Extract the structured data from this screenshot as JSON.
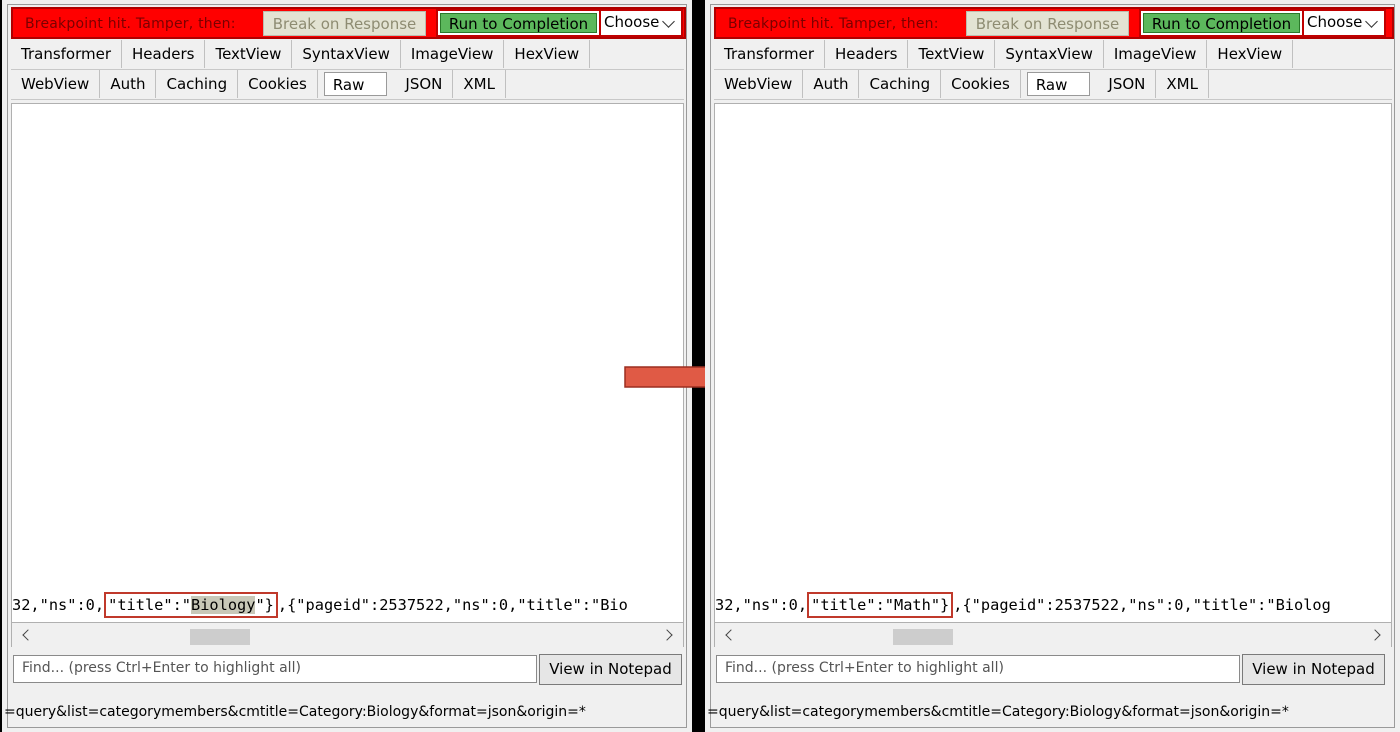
{
  "breakpoint_text": "Breakpoint hit. Tamper, then:",
  "buttons": {
    "break_on_response": "Break on Response",
    "run_to_completion": "Run to Completion",
    "choose": "Choose",
    "view_in_notepad": "View in Notepad"
  },
  "tabs_row1": [
    "Transformer",
    "Headers",
    "TextView",
    "SyntaxView",
    "ImageView",
    "HexView"
  ],
  "tabs_row2": [
    "WebView",
    "Auth",
    "Caching",
    "Cookies",
    "Raw",
    "JSON",
    "XML"
  ],
  "active_tab": "Raw",
  "find_placeholder": "Find... (press Ctrl+Enter to highlight all)",
  "status_text": "=query&list=categorymembers&cmtitle=Category:Biology&format=json&origin=*",
  "before": {
    "code_prefix": "32,\"ns\":0,",
    "code_highlight_key": "\"title\":\"",
    "code_highlight_value": "Biology",
    "code_highlight_end": "\"}",
    "code_suffix": ",{\"pageid\":2537522,\"ns\":0,\"title\":\"Bio"
  },
  "after": {
    "code_prefix": "32,\"ns\":0,",
    "code_highlight_key": "\"title\":\"",
    "code_highlight_value": "Math",
    "code_highlight_end": "\"}",
    "code_suffix": ",{\"pageid\":2537522,\"ns\":0,\"title\":\"Biolog"
  },
  "colors": {
    "breakpoint_bar": "#ff0000",
    "run_button": "#5cb85c",
    "highlight_border": "#c0392b",
    "arrow": "#e05a45"
  },
  "icons": [
    "chevron-down-icon",
    "scroll-left-arrow-icon",
    "scroll-right-arrow-icon",
    "transition-arrow-icon"
  ]
}
